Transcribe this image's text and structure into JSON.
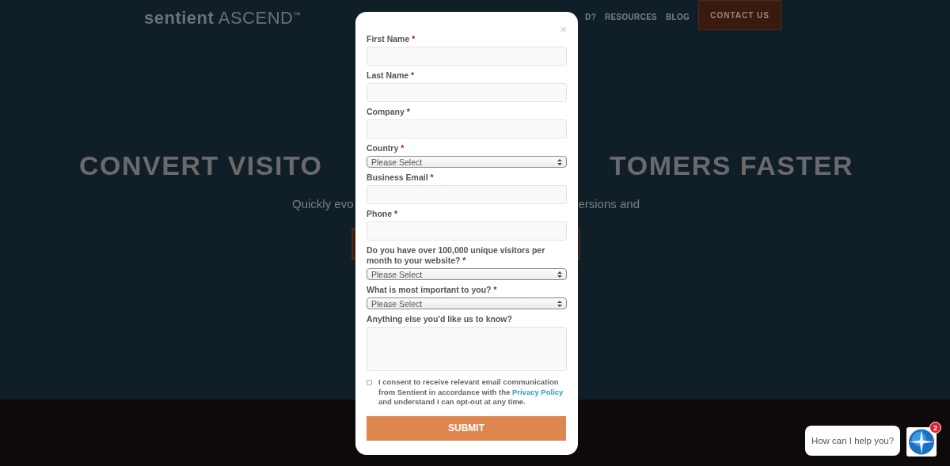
{
  "header": {
    "logo": "**sentient** ASCEND$^{™}$",
    "nav": [
      "D?",
      "RESOURCES",
      "BLOG"
    ],
    "contact_button": "CONTACT US"
  },
  "hero": {
    "heading_left": "CONVERT VISITO",
    "heading_right": "TOMERS FASTER",
    "subtitle_left": "Quickly evo",
    "subtitle_right": "ersions and"
  },
  "modal": {
    "close": "×",
    "fields": [
      {
        "kind": "text",
        "label": "First Name",
        "mark": "*"
      },
      {
        "kind": "text",
        "label": "Last Name",
        "mark": "*"
      },
      {
        "kind": "text",
        "label": "Company",
        "mark": "*"
      },
      {
        "kind": "select",
        "label": "Country",
        "mark": "*",
        "placeholder": "Please Select"
      },
      {
        "kind": "text",
        "label": "Business Email",
        "mark": "*"
      },
      {
        "kind": "text",
        "label": "Phone",
        "mark": "*"
      },
      {
        "kind": "select",
        "label": "Do you have over 100,000 unique visitors per month to your website?",
        "mark": "*",
        "placeholder": "Please Select"
      },
      {
        "kind": "select",
        "label": "What is most important to you?",
        "mark": "*",
        "placeholder": "Please Select"
      },
      {
        "kind": "textarea",
        "label": "Anything else you'd like us to know?"
      }
    ],
    "consent": {
      "checked": false,
      "text": "I consent to receive relevant email communication from Sentient in accordance with the",
      "link": "Privacy Policy",
      "text_after": "and understand I can opt-out at any time."
    },
    "submit": "SUBMIT"
  },
  "chat": {
    "message": "How can I help you?",
    "badge": "2"
  }
}
